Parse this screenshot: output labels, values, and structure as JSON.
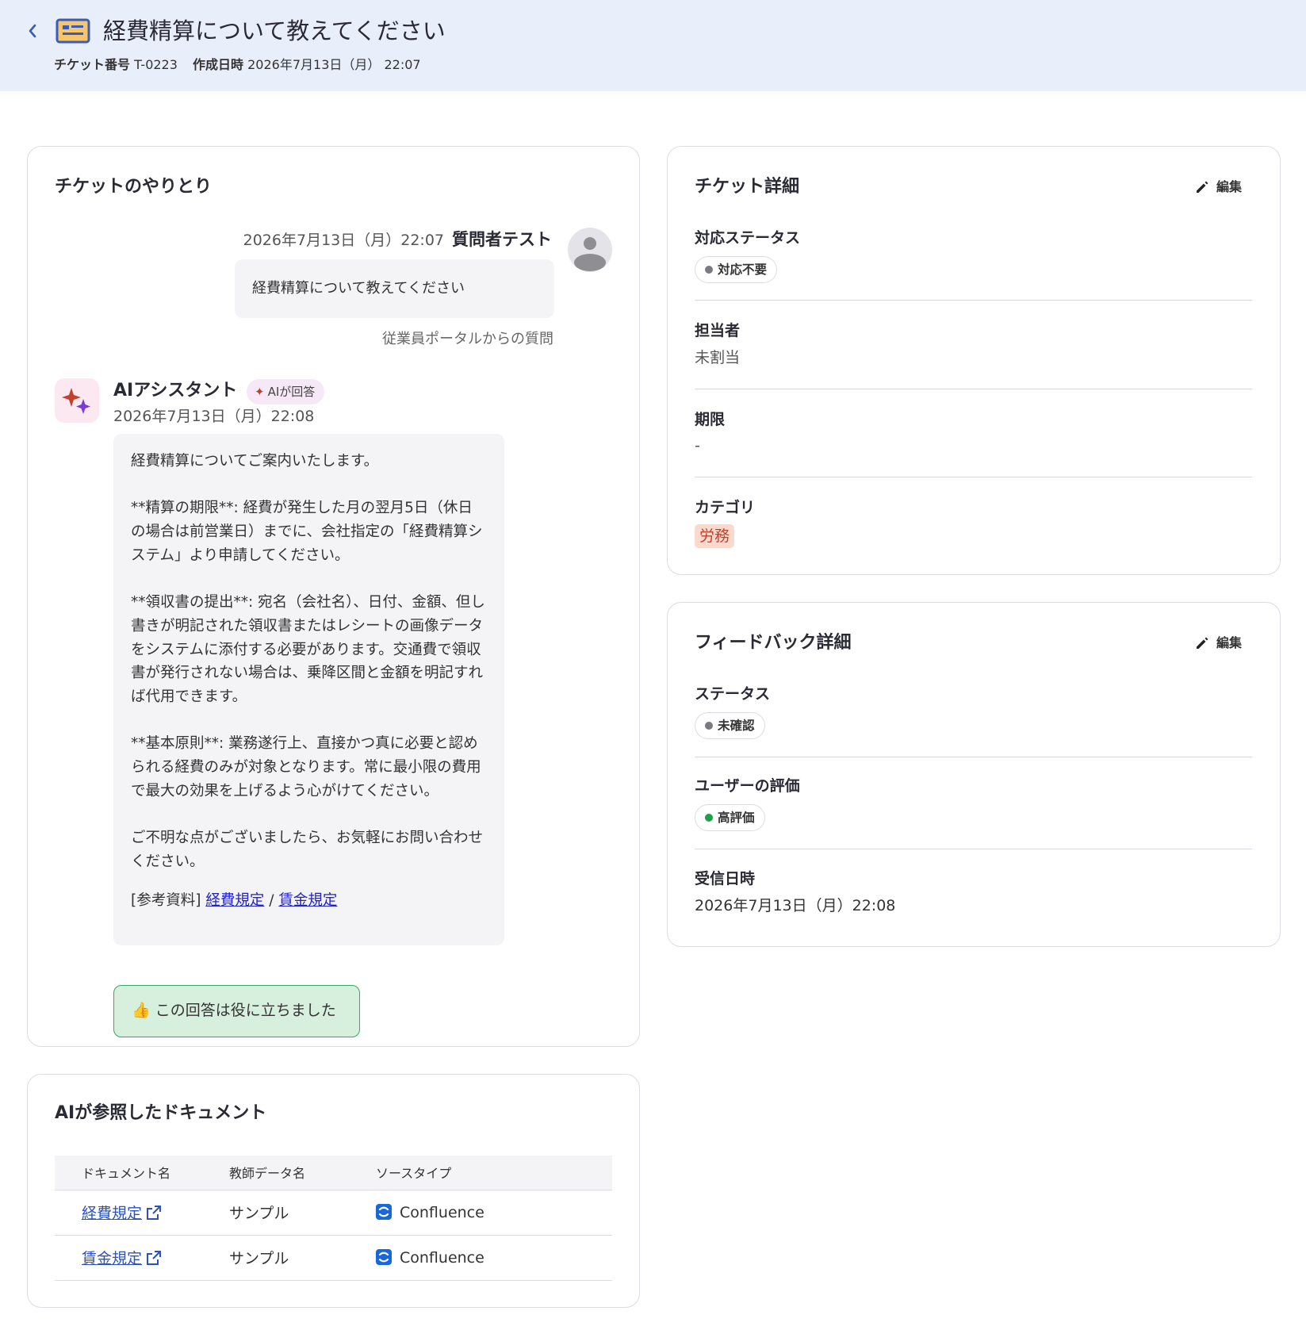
{
  "header": {
    "title": "経費精算について教えてください",
    "ticket_number_label": "チケット番号",
    "ticket_number": "T-0223",
    "created_label": "作成日時",
    "created_at": "2026年7月13日（月） 22:07"
  },
  "conversation": {
    "title": "チケットのやりとり",
    "question": {
      "time": "2026年7月13日（月）22:07",
      "author": "質問者テスト",
      "text": "経費精算について教えてください",
      "source": "従業員ポータルからの質問"
    },
    "answer": {
      "author": "AIアシスタント",
      "badge": "AIが回答",
      "time": "2026年7月13日（月）22:08",
      "paragraphs": [
        "経費精算についてご案内いたします。",
        "**精算の期限**: 経費が発生した月の翌月5日（休日の場合は前営業日）までに、会社指定の「経費精算システム」より申請してください。",
        "**領収書の提出**: 宛名（会社名）、日付、金額、但し書きが明記された領収書またはレシートの画像データをシステムに添付する必要があります。交通費で領収書が発行されない場合は、乗降区間と金額を明記すれば代用できます。",
        "**基本原則**: 業務遂行上、直接かつ真に必要と認められる経費のみが対象となります。常に最小限の費用で最大の効果を上げるよう心がけてください。",
        "ご不明な点がございましたら、お気軽にお問い合わせください。"
      ],
      "refs_label": "[参考資料]",
      "refs": [
        "経費規定",
        "賃金規定"
      ],
      "refs_separator": "/"
    },
    "helpful_button": "👍 この回答は役に立ちました"
  },
  "documents": {
    "title": "AIが参照したドキュメント",
    "columns": [
      "ドキュメント名",
      "教師データ名",
      "ソースタイプ"
    ],
    "rows": [
      {
        "name": "経費規定",
        "training_data": "サンプル",
        "source_type": "Confluence"
      },
      {
        "name": "賃金規定",
        "training_data": "サンプル",
        "source_type": "Confluence"
      }
    ]
  },
  "ticket_detail": {
    "title": "チケット詳細",
    "edit_label": "編集",
    "status_label": "対応ステータス",
    "status_value": "対応不要",
    "status_color": "#7a7a80",
    "assignee_label": "担当者",
    "assignee_value": "未割当",
    "deadline_label": "期限",
    "deadline_value": "-",
    "category_label": "カテゴリ",
    "category_value": "労務"
  },
  "feedback_detail": {
    "title": "フィードバック詳細",
    "edit_label": "編集",
    "status_label": "ステータス",
    "status_value": "未確認",
    "status_color": "#7a7a80",
    "rating_label": "ユーザーの評価",
    "rating_value": "高評価",
    "rating_color": "#1f9d48",
    "received_label": "受信日時",
    "received_value": "2026年7月13日（月）22:08"
  },
  "icons": {
    "back": "chevron-left-icon",
    "ticket": "ticket-icon",
    "avatar": "user-avatar-icon",
    "ai": "sparkle-icon",
    "edit": "pencil-icon",
    "external": "external-link-icon",
    "confluence": "confluence-icon"
  }
}
